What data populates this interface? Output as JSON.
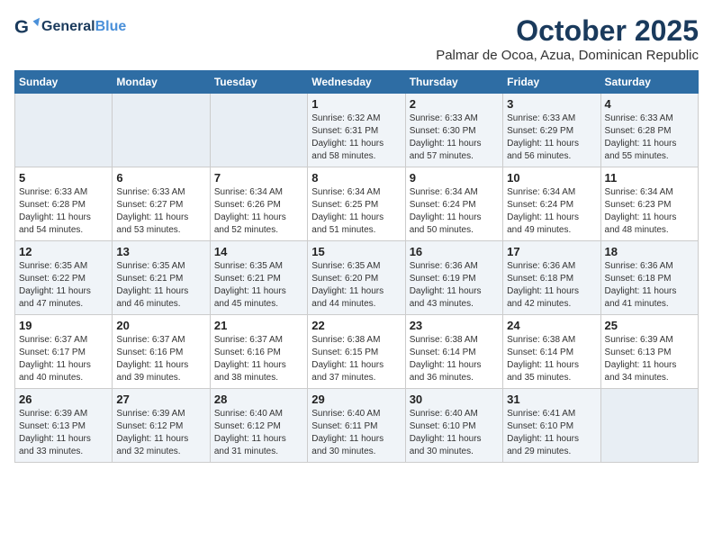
{
  "header": {
    "logo_line1": "General",
    "logo_line2": "Blue",
    "month": "October 2025",
    "location": "Palmar de Ocoa, Azua, Dominican Republic"
  },
  "weekdays": [
    "Sunday",
    "Monday",
    "Tuesday",
    "Wednesday",
    "Thursday",
    "Friday",
    "Saturday"
  ],
  "weeks": [
    [
      {
        "day": "",
        "info": ""
      },
      {
        "day": "",
        "info": ""
      },
      {
        "day": "",
        "info": ""
      },
      {
        "day": "1",
        "info": "Sunrise: 6:32 AM\nSunset: 6:31 PM\nDaylight: 11 hours\nand 58 minutes."
      },
      {
        "day": "2",
        "info": "Sunrise: 6:33 AM\nSunset: 6:30 PM\nDaylight: 11 hours\nand 57 minutes."
      },
      {
        "day": "3",
        "info": "Sunrise: 6:33 AM\nSunset: 6:29 PM\nDaylight: 11 hours\nand 56 minutes."
      },
      {
        "day": "4",
        "info": "Sunrise: 6:33 AM\nSunset: 6:28 PM\nDaylight: 11 hours\nand 55 minutes."
      }
    ],
    [
      {
        "day": "5",
        "info": "Sunrise: 6:33 AM\nSunset: 6:28 PM\nDaylight: 11 hours\nand 54 minutes."
      },
      {
        "day": "6",
        "info": "Sunrise: 6:33 AM\nSunset: 6:27 PM\nDaylight: 11 hours\nand 53 minutes."
      },
      {
        "day": "7",
        "info": "Sunrise: 6:34 AM\nSunset: 6:26 PM\nDaylight: 11 hours\nand 52 minutes."
      },
      {
        "day": "8",
        "info": "Sunrise: 6:34 AM\nSunset: 6:25 PM\nDaylight: 11 hours\nand 51 minutes."
      },
      {
        "day": "9",
        "info": "Sunrise: 6:34 AM\nSunset: 6:24 PM\nDaylight: 11 hours\nand 50 minutes."
      },
      {
        "day": "10",
        "info": "Sunrise: 6:34 AM\nSunset: 6:24 PM\nDaylight: 11 hours\nand 49 minutes."
      },
      {
        "day": "11",
        "info": "Sunrise: 6:34 AM\nSunset: 6:23 PM\nDaylight: 11 hours\nand 48 minutes."
      }
    ],
    [
      {
        "day": "12",
        "info": "Sunrise: 6:35 AM\nSunset: 6:22 PM\nDaylight: 11 hours\nand 47 minutes."
      },
      {
        "day": "13",
        "info": "Sunrise: 6:35 AM\nSunset: 6:21 PM\nDaylight: 11 hours\nand 46 minutes."
      },
      {
        "day": "14",
        "info": "Sunrise: 6:35 AM\nSunset: 6:21 PM\nDaylight: 11 hours\nand 45 minutes."
      },
      {
        "day": "15",
        "info": "Sunrise: 6:35 AM\nSunset: 6:20 PM\nDaylight: 11 hours\nand 44 minutes."
      },
      {
        "day": "16",
        "info": "Sunrise: 6:36 AM\nSunset: 6:19 PM\nDaylight: 11 hours\nand 43 minutes."
      },
      {
        "day": "17",
        "info": "Sunrise: 6:36 AM\nSunset: 6:18 PM\nDaylight: 11 hours\nand 42 minutes."
      },
      {
        "day": "18",
        "info": "Sunrise: 6:36 AM\nSunset: 6:18 PM\nDaylight: 11 hours\nand 41 minutes."
      }
    ],
    [
      {
        "day": "19",
        "info": "Sunrise: 6:37 AM\nSunset: 6:17 PM\nDaylight: 11 hours\nand 40 minutes."
      },
      {
        "day": "20",
        "info": "Sunrise: 6:37 AM\nSunset: 6:16 PM\nDaylight: 11 hours\nand 39 minutes."
      },
      {
        "day": "21",
        "info": "Sunrise: 6:37 AM\nSunset: 6:16 PM\nDaylight: 11 hours\nand 38 minutes."
      },
      {
        "day": "22",
        "info": "Sunrise: 6:38 AM\nSunset: 6:15 PM\nDaylight: 11 hours\nand 37 minutes."
      },
      {
        "day": "23",
        "info": "Sunrise: 6:38 AM\nSunset: 6:14 PM\nDaylight: 11 hours\nand 36 minutes."
      },
      {
        "day": "24",
        "info": "Sunrise: 6:38 AM\nSunset: 6:14 PM\nDaylight: 11 hours\nand 35 minutes."
      },
      {
        "day": "25",
        "info": "Sunrise: 6:39 AM\nSunset: 6:13 PM\nDaylight: 11 hours\nand 34 minutes."
      }
    ],
    [
      {
        "day": "26",
        "info": "Sunrise: 6:39 AM\nSunset: 6:13 PM\nDaylight: 11 hours\nand 33 minutes."
      },
      {
        "day": "27",
        "info": "Sunrise: 6:39 AM\nSunset: 6:12 PM\nDaylight: 11 hours\nand 32 minutes."
      },
      {
        "day": "28",
        "info": "Sunrise: 6:40 AM\nSunset: 6:12 PM\nDaylight: 11 hours\nand 31 minutes."
      },
      {
        "day": "29",
        "info": "Sunrise: 6:40 AM\nSunset: 6:11 PM\nDaylight: 11 hours\nand 30 minutes."
      },
      {
        "day": "30",
        "info": "Sunrise: 6:40 AM\nSunset: 6:10 PM\nDaylight: 11 hours\nand 30 minutes."
      },
      {
        "day": "31",
        "info": "Sunrise: 6:41 AM\nSunset: 6:10 PM\nDaylight: 11 hours\nand 29 minutes."
      },
      {
        "day": "",
        "info": ""
      }
    ]
  ]
}
